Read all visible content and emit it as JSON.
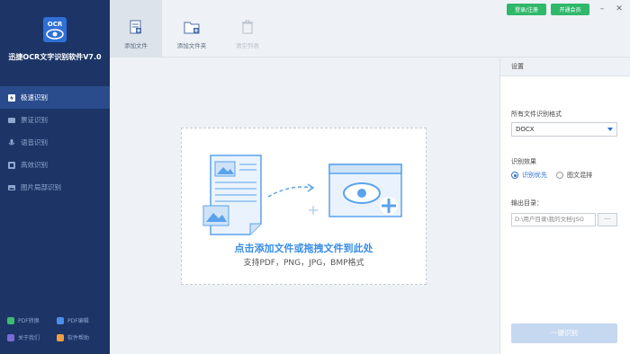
{
  "app": {
    "title": "迅捷OCR文字识别软件V7.0",
    "logo_text": "OCR"
  },
  "sidebar": {
    "items": [
      {
        "label": "极速识别",
        "icon": "lightning-icon",
        "active": true
      },
      {
        "label": "票证识别",
        "icon": "ticket-icon",
        "active": false
      },
      {
        "label": "语音识别",
        "icon": "microphone-icon",
        "active": false
      },
      {
        "label": "高效识别",
        "icon": "speed-icon",
        "active": false
      },
      {
        "label": "图片局部识别",
        "icon": "image-crop-icon",
        "active": false
      }
    ],
    "footer": [
      {
        "label": "PDF转换",
        "icon": "pdf-convert-icon",
        "color": "#3dbb6f"
      },
      {
        "label": "PDF编辑",
        "icon": "pdf-edit-icon",
        "color": "#4a8fe8"
      },
      {
        "label": "关于我们",
        "icon": "about-icon",
        "color": "#7a6ad8"
      },
      {
        "label": "软件帮助",
        "icon": "help-icon",
        "color": "#f0a040"
      }
    ]
  },
  "toolbar": {
    "add_file": "添加文件",
    "add_folder": "添加文件夹",
    "clear_list": "清空列表",
    "login": "登录/注册",
    "vip": "开通会员"
  },
  "dropzone": {
    "main_text": "点击添加文件或拖拽文件到此处",
    "sub_text": "支持PDF，PNG，JPG，BMP格式"
  },
  "settings": {
    "title": "设置",
    "format_label": "所有文件识别格式",
    "format_value": "DOCX",
    "effect_label": "识别效果",
    "effect_options": [
      "识别优先",
      "图文混排"
    ],
    "output_label": "输出目录：",
    "output_value": "D:\\用户目录\\我的文档\\JSO",
    "browse_label": "···",
    "start_button": "一键识别"
  },
  "colors": {
    "sidebar_bg": "#1c3566",
    "accent": "#2a6fd1",
    "green": "#2fb86a"
  }
}
